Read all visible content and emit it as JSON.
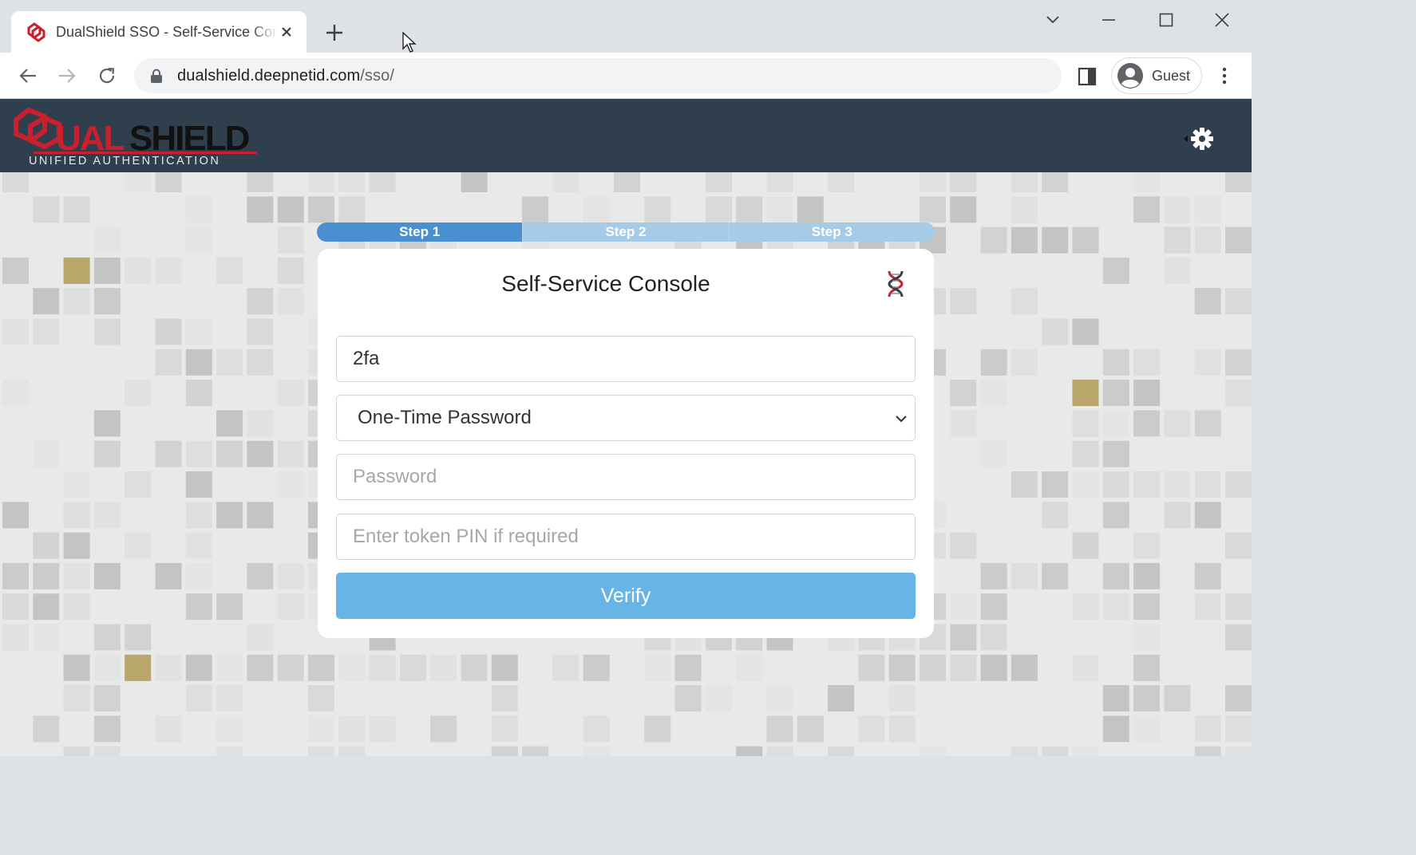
{
  "browser": {
    "tab_title": "DualShield SSO - Self-Service Console",
    "url_host": "dualshield.deepnetid.com",
    "url_path": "/sso/",
    "profile_label": "Guest"
  },
  "app": {
    "logo_text_main": "DUALSHIELD",
    "logo_text_sub": "UNIFIED AUTHENTICATION",
    "brand_red": "#c8202f",
    "header_color": "#2f3f4e"
  },
  "steps": [
    {
      "label": "Step 1",
      "active": true
    },
    {
      "label": "Step 2",
      "active": false
    },
    {
      "label": "Step 3",
      "active": false
    }
  ],
  "console": {
    "title": "Self-Service Console",
    "username_value": "2fa",
    "method_selected": "One-Time Password",
    "password_placeholder": "Password",
    "pin_placeholder": "Enter token PIN if required",
    "verify_label": "Verify"
  }
}
